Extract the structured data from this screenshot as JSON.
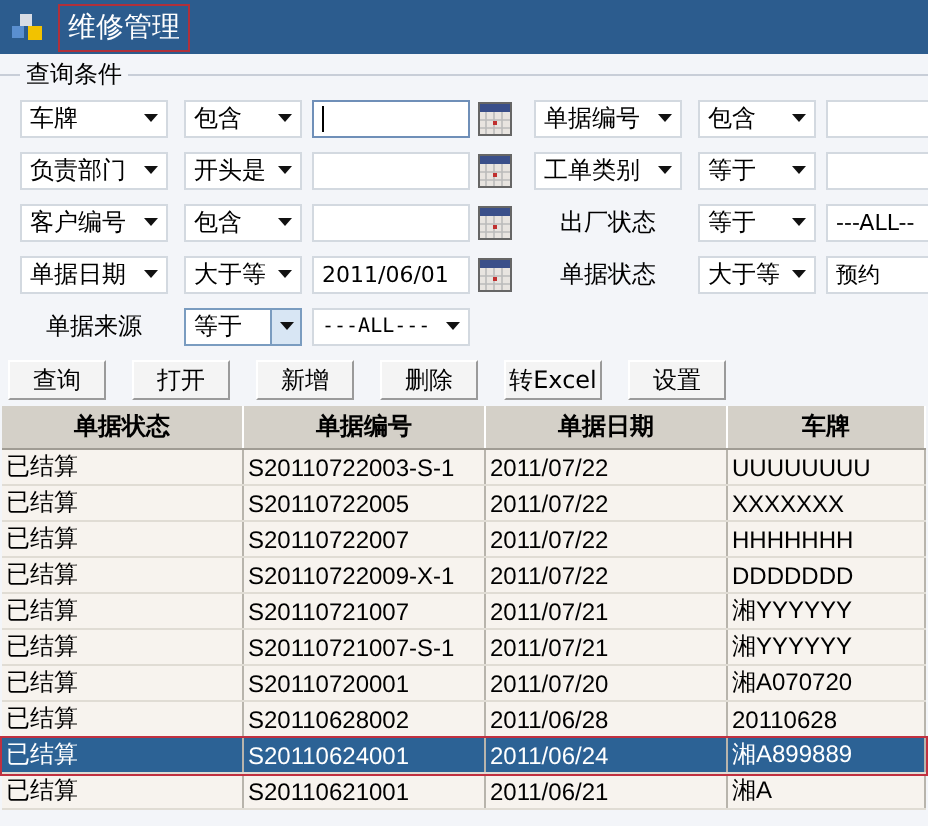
{
  "window": {
    "title": "维修管理"
  },
  "filter_group": {
    "legend": "查询条件",
    "rows": [
      {
        "left": {
          "field": {
            "kind": "dropdown",
            "text": "车牌"
          },
          "operator": {
            "text": "包含",
            "focused": false
          },
          "value": {
            "kind": "input",
            "focused": true
          },
          "calendar": true
        },
        "right": {
          "field": {
            "kind": "dropdown",
            "text": "单据编号"
          },
          "operator": {
            "text": "包含",
            "focused": false
          },
          "value": {
            "kind": "input"
          }
        }
      },
      {
        "left": {
          "field": {
            "kind": "dropdown",
            "text": "负责部门"
          },
          "operator": {
            "text": "开头是",
            "focused": false
          },
          "value": {
            "kind": "input"
          },
          "calendar": true
        },
        "right": {
          "field": {
            "kind": "dropdown",
            "text": "工单类别"
          },
          "operator": {
            "text": "等于",
            "focused": false
          },
          "value": {
            "kind": "input"
          }
        }
      },
      {
        "left": {
          "field": {
            "kind": "dropdown",
            "text": "客户编号"
          },
          "operator": {
            "text": "包含",
            "focused": false
          },
          "value": {
            "kind": "input"
          },
          "calendar": true
        },
        "right": {
          "field": {
            "kind": "label",
            "text": "出厂状态"
          },
          "operator": {
            "text": "等于",
            "focused": false
          },
          "value": {
            "kind": "input",
            "text": "---ALL--"
          }
        }
      },
      {
        "left": {
          "field": {
            "kind": "dropdown",
            "text": "单据日期"
          },
          "operator": {
            "text": "大于等",
            "focused": false
          },
          "value": {
            "kind": "input",
            "text": "2011/06/01"
          },
          "calendar": true
        },
        "right": {
          "field": {
            "kind": "label",
            "text": "单据状态"
          },
          "operator": {
            "text": "大于等",
            "focused": false
          },
          "value": {
            "kind": "input",
            "text": "预约"
          }
        }
      },
      {
        "left": {
          "field": {
            "kind": "label",
            "text": "单据来源"
          },
          "operator": {
            "text": "等于",
            "focused": true
          },
          "value": {
            "kind": "dropdown",
            "text": "---ALL---"
          },
          "calendar": false
        }
      }
    ]
  },
  "buttons": [
    "查询",
    "打开",
    "新增",
    "删除",
    "转Excel",
    "设置"
  ],
  "table": {
    "columns": [
      "单据状态",
      "单据编号",
      "单据日期",
      "车牌"
    ],
    "rows": [
      {
        "cells": [
          "已结算",
          "S20110722003-S-1",
          "2011/07/22",
          "UUUUUUUU"
        ],
        "selected": false
      },
      {
        "cells": [
          "已结算",
          "S20110722005",
          "2011/07/22",
          "XXXXXXX"
        ],
        "selected": false
      },
      {
        "cells": [
          "已结算",
          "S20110722007",
          "2011/07/22",
          "HHHHHHH"
        ],
        "selected": false
      },
      {
        "cells": [
          "已结算",
          "S20110722009-X-1",
          "2011/07/22",
          "DDDDDDD"
        ],
        "selected": false
      },
      {
        "cells": [
          "已结算",
          "S20110721007",
          "2011/07/21",
          "湘YYYYYY"
        ],
        "selected": false
      },
      {
        "cells": [
          "已结算",
          "S20110721007-S-1",
          "2011/07/21",
          "湘YYYYYY"
        ],
        "selected": false
      },
      {
        "cells": [
          "已结算",
          "S20110720001",
          "2011/07/20",
          "湘A070720"
        ],
        "selected": false
      },
      {
        "cells": [
          "已结算",
          "S20110628002",
          "2011/06/28",
          "20110628"
        ],
        "selected": false
      },
      {
        "cells": [
          "已结算",
          "S20110624001",
          "2011/06/24",
          "湘A899889"
        ],
        "selected": true
      },
      {
        "cells": [
          "已结算",
          "S20110621001",
          "2011/06/21",
          "湘A"
        ],
        "selected": false
      }
    ]
  }
}
